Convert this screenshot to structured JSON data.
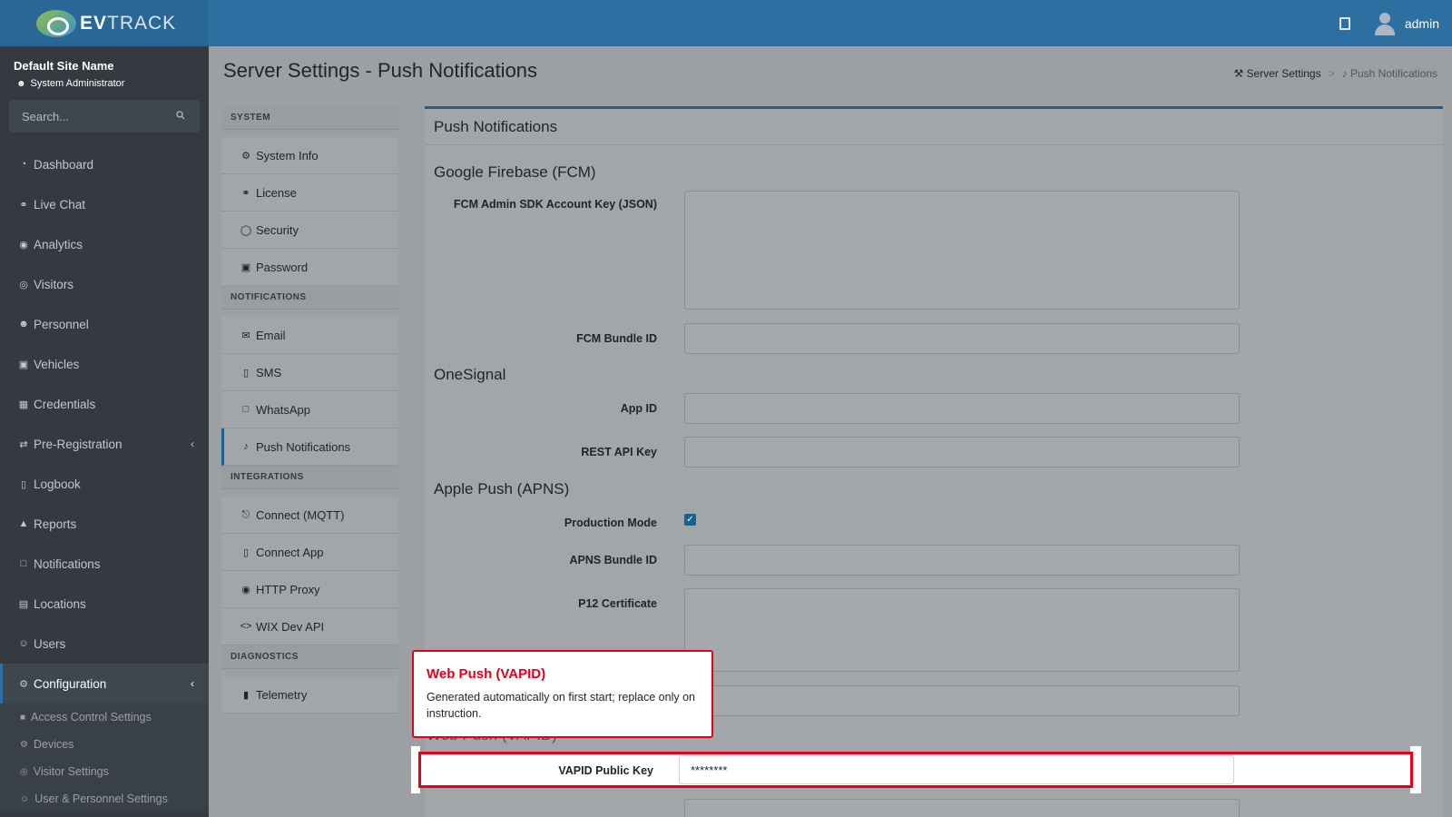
{
  "topbar": {
    "brand_bold": "EV",
    "brand_rest": "TRACK",
    "username": "admin"
  },
  "sidebar": {
    "site_name": "Default Site Name",
    "site_role": "System Administrator",
    "search_placeholder": "Search...",
    "items": [
      {
        "label": "Dashboard",
        "icon": "dashboard-icon"
      },
      {
        "label": "Live Chat",
        "icon": "headset-icon"
      },
      {
        "label": "Analytics",
        "icon": "target-icon"
      },
      {
        "label": "Visitors",
        "icon": "eye-icon"
      },
      {
        "label": "Personnel",
        "icon": "person-icon"
      },
      {
        "label": "Vehicles",
        "icon": "car-icon"
      },
      {
        "label": "Credentials",
        "icon": "badge-icon"
      },
      {
        "label": "Pre-Registration",
        "icon": "arrows-icon"
      },
      {
        "label": "Logbook",
        "icon": "book-icon"
      },
      {
        "label": "Reports",
        "icon": "chart-icon"
      },
      {
        "label": "Notifications",
        "icon": "chat-icon"
      },
      {
        "label": "Locations",
        "icon": "map-icon"
      },
      {
        "label": "Users",
        "icon": "users-icon"
      },
      {
        "label": "Configuration",
        "icon": "gear-icon"
      }
    ],
    "sub_items": [
      {
        "label": "Access Control Settings"
      },
      {
        "label": "Devices"
      },
      {
        "label": "Visitor Settings"
      },
      {
        "label": "User & Personnel Settings"
      }
    ]
  },
  "page": {
    "title": "Server Settings - Push Notifications",
    "breadcrumb": [
      "Server Settings",
      "Push Notifications"
    ]
  },
  "settings_menu": {
    "system_heading": "SYSTEM",
    "system_items": [
      "System Info",
      "License",
      "Security",
      "Password"
    ],
    "notifications_heading": "NOTIFICATIONS",
    "notifications_items": [
      "Email",
      "SMS",
      "WhatsApp",
      "Push Notifications"
    ],
    "integrations_heading": "INTEGRATIONS",
    "integrations_items": [
      "Connect (MQTT)",
      "Connect App",
      "HTTP Proxy",
      "WIX Dev API"
    ],
    "diagnostics_heading": "DIAGNOSTICS",
    "diagnostics_items": [
      "Telemetry"
    ]
  },
  "card": {
    "title": "Push Notifications",
    "fcm_title": "Google Firebase (FCM)",
    "fcm_key_label": "FCM Admin SDK Account Key (JSON)",
    "fcm_bundle_label": "FCM Bundle ID",
    "onesignal_title": "OneSignal",
    "app_id_label": "App ID",
    "rest_key_label": "REST API Key",
    "apns_title": "Apple Push (APNS)",
    "production_label": "Production Mode",
    "production_checked": true,
    "apns_bundle_label": "APNS Bundle ID",
    "p12_label": "P12 Certificate",
    "vapid_public_label": "VAPID Public Key",
    "vapid_public_value": "********"
  },
  "callout": {
    "title": "Web Push (VAPID)",
    "body": "Generated automatically on first start; replace only on instruction."
  },
  "colors": {
    "accent": "#2d6fa1",
    "highlight": "#e4001b"
  }
}
